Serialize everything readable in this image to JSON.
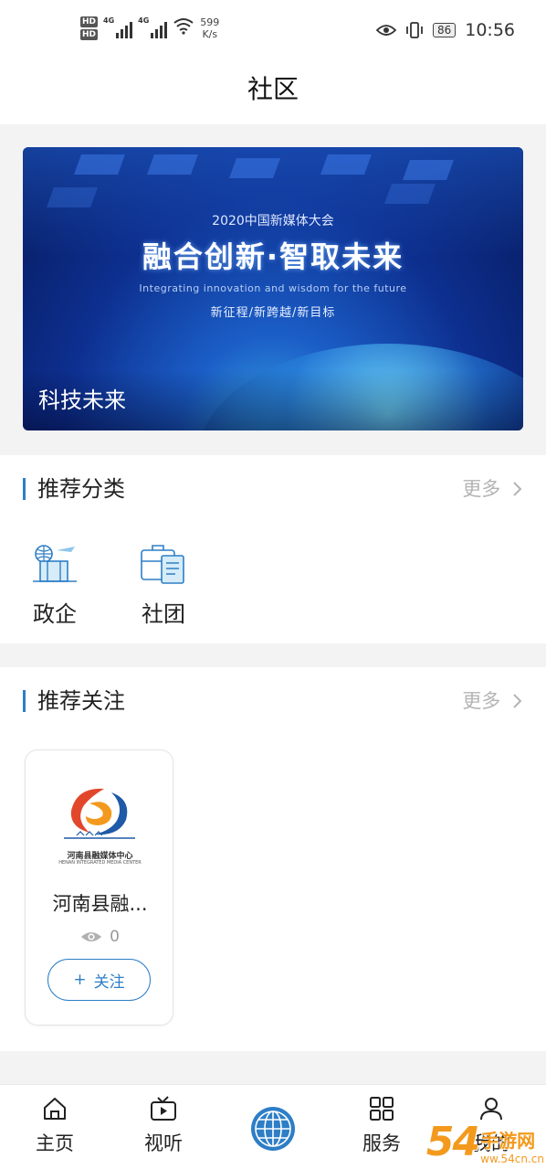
{
  "status_bar": {
    "network_badges": [
      "HD",
      "HD"
    ],
    "signal_labels": [
      "4G",
      "4G"
    ],
    "speed_value": "599",
    "speed_unit": "K/s",
    "battery": "86",
    "time": "10:56"
  },
  "header": {
    "title": "社区"
  },
  "banner": {
    "top_text": "2020中国新媒体大会",
    "headline": "融合创新·智取未来",
    "english": "Integrating innovation and wisdom for the future",
    "subline": "新征程/新跨越/新目标",
    "caption": "科技未来"
  },
  "recommended_categories": {
    "title": "推荐分类",
    "more": "更多",
    "items": [
      {
        "label": "政企",
        "icon": "government-enterprise-icon"
      },
      {
        "label": "社团",
        "icon": "community-group-icon"
      }
    ]
  },
  "recommended_follow": {
    "title": "推荐关注",
    "more": "更多",
    "cards": [
      {
        "logo_text": "河南县融媒体中心",
        "logo_english": "HENAN INTEGRATED MEDIA CENTER",
        "name": "河南县融...",
        "views": "0",
        "follow_label": "关注"
      }
    ]
  },
  "tab_bar": {
    "items": [
      {
        "label": "主页",
        "icon": "home-icon"
      },
      {
        "label": "视听",
        "icon": "video-icon"
      },
      {
        "label": "",
        "icon": "globe-icon"
      },
      {
        "label": "服务",
        "icon": "grid-icon"
      },
      {
        "label": "我的",
        "icon": "user-icon"
      }
    ]
  },
  "watermark": {
    "digits": "54",
    "text": "手游网",
    "url": "ww.54cn.cn"
  },
  "colors": {
    "accent": "#2d7ec6",
    "more": "#b4b4b4",
    "watermark": "#f39a1e"
  }
}
